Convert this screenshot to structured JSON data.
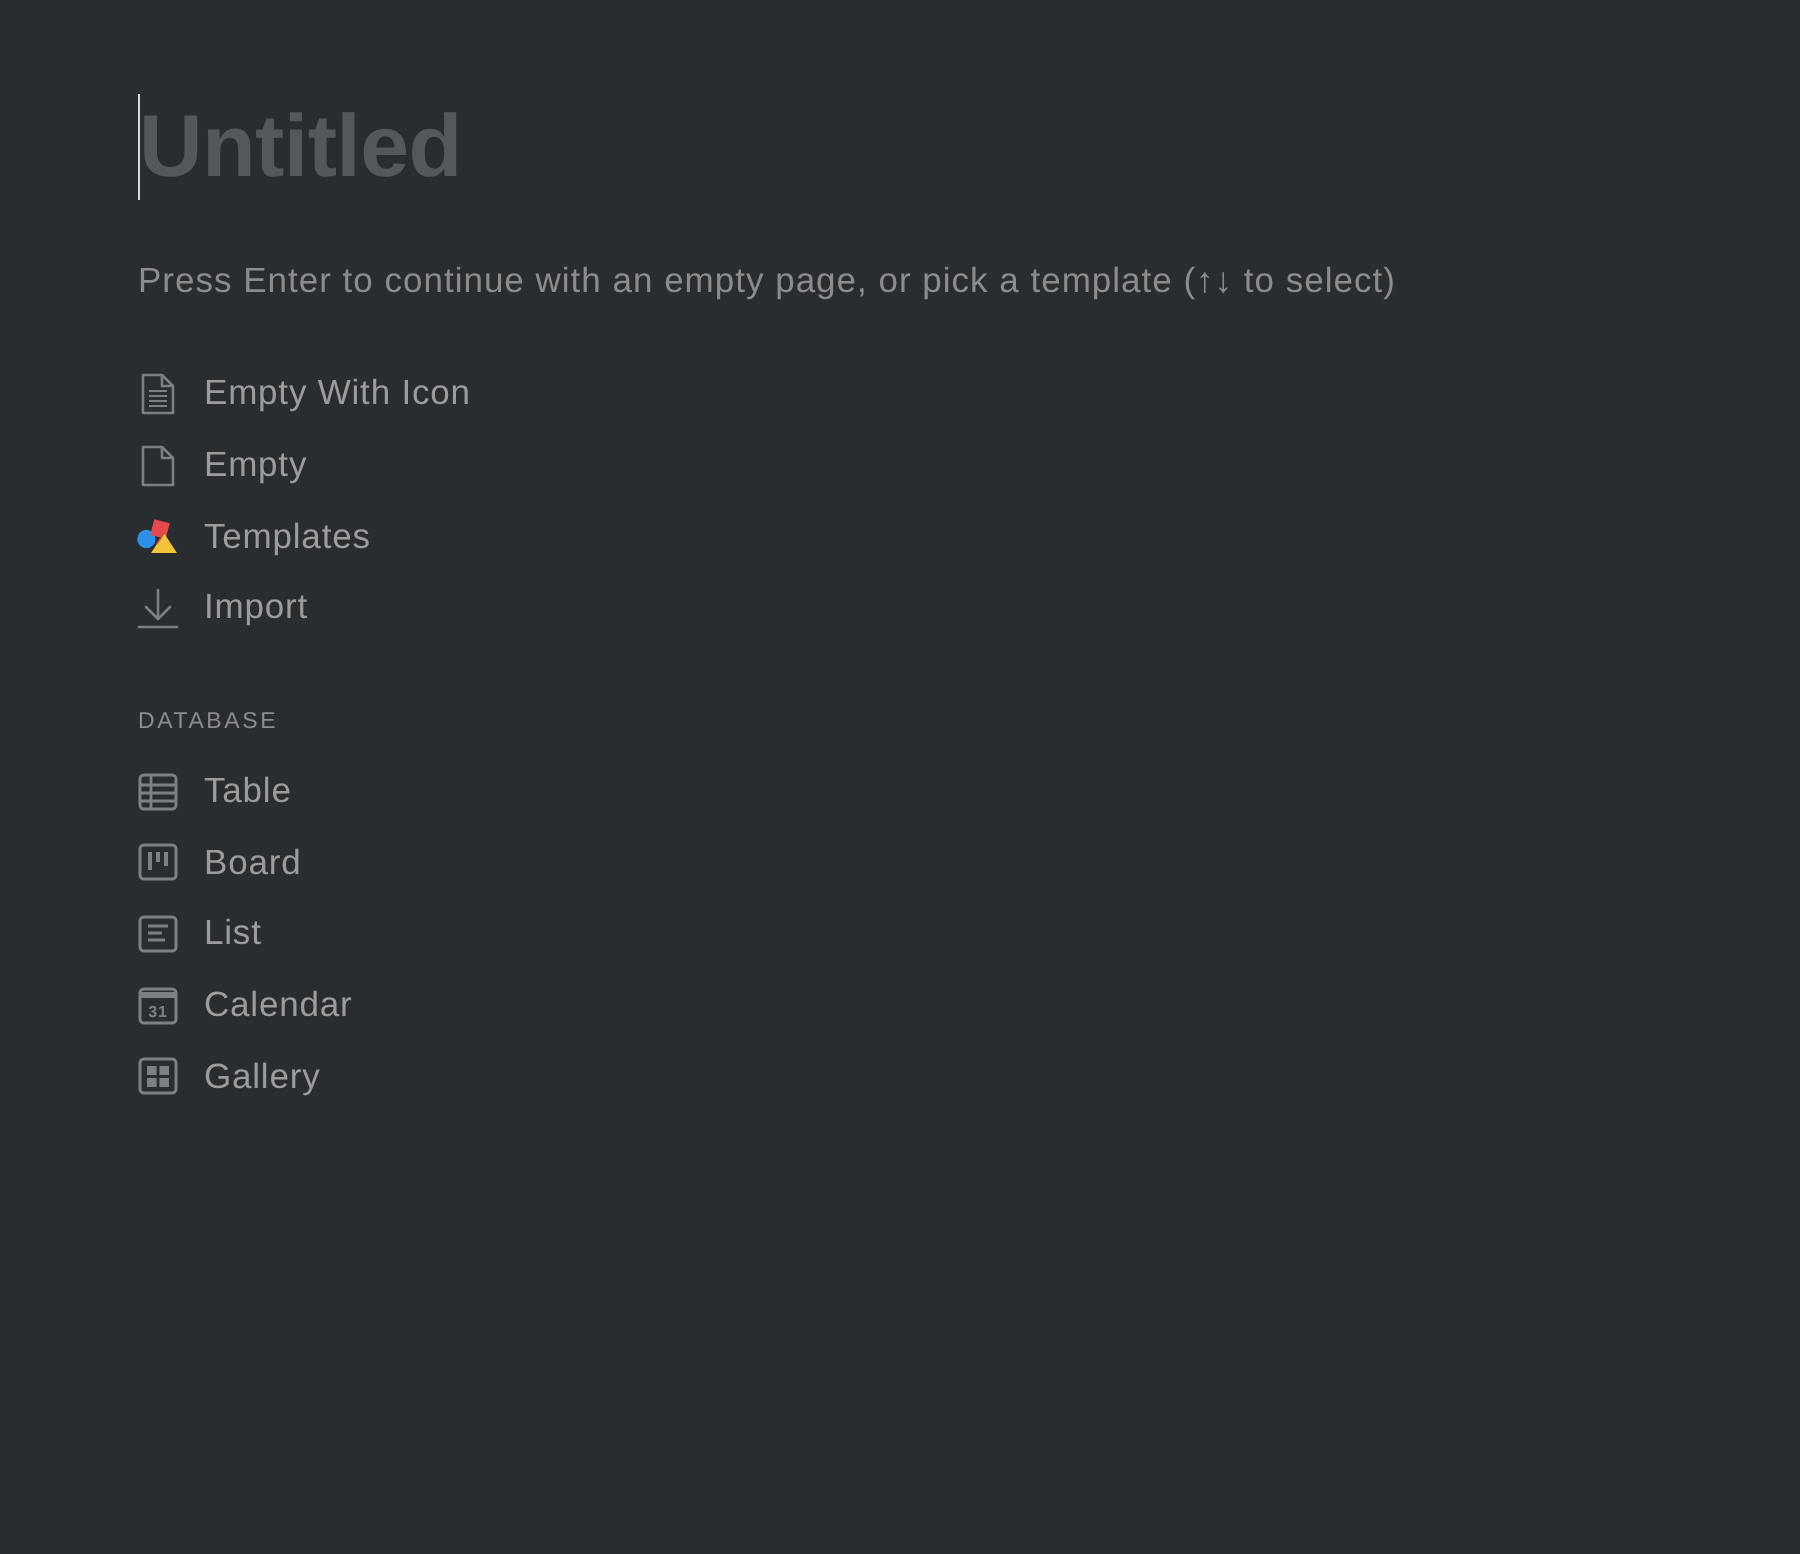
{
  "title_field": {
    "placeholder": "Untitled"
  },
  "hint": "Press Enter to continue with an empty page, or pick a template (↑↓ to select)",
  "options": [
    {
      "kind": "page-lines",
      "label": "Empty With Icon"
    },
    {
      "kind": "page",
      "label": "Empty"
    },
    {
      "kind": "shapes",
      "label": "Templates"
    },
    {
      "kind": "import",
      "label": "Import"
    }
  ],
  "database": {
    "heading": "DATABASE",
    "options": [
      {
        "kind": "table",
        "label": "Table"
      },
      {
        "kind": "board",
        "label": "Board"
      },
      {
        "kind": "list",
        "label": "List"
      },
      {
        "kind": "calendar",
        "label": "Calendar",
        "icon_text": "31"
      },
      {
        "kind": "gallery",
        "label": "Gallery"
      }
    ]
  }
}
